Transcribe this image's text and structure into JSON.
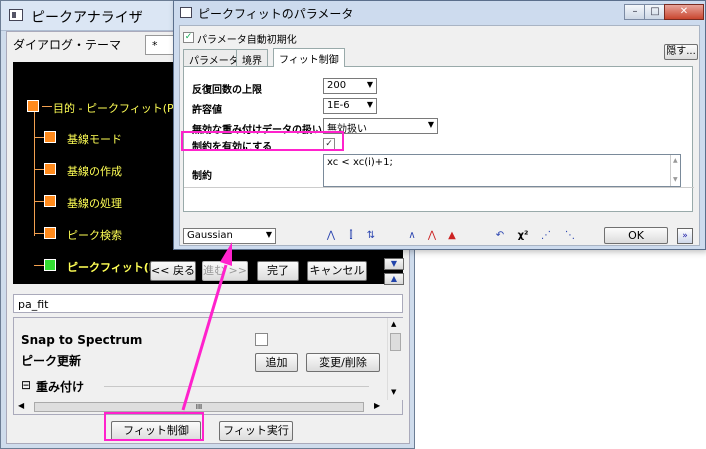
{
  "peak_analyzer": {
    "title": "ピークアナライザ",
    "theme_label": "ダイアログ・テーマ",
    "theme_value": "*",
    "tree": {
      "root": "目的 - ピークフィット(Pro)",
      "items": [
        "基線モード",
        "基線の作成",
        "基線の処理",
        "ピーク検索",
        "ピークフィット(Pro)"
      ]
    },
    "nav": {
      "prev": "<< 戻る",
      "next": "進む >>",
      "finish": "完了",
      "cancel": "キャンセル"
    },
    "output_name": "pa_fit",
    "panel": {
      "snap_label": "Snap to Spectrum",
      "peak_update_label": "ピーク更新",
      "add_button": "追加",
      "modify_button": "変更/削除",
      "weight_section": "重み付け",
      "collapse_glyph": "⊟",
      "hscroll_thumb": "III"
    },
    "bottom_buttons": {
      "fit_control": "フィット制御",
      "fit_run": "フィット実行"
    }
  },
  "fit_params": {
    "title": "ピークフィットのパラメータ",
    "auto_init_label": "パラメータ自動初期化",
    "auto_init_checked": true,
    "hide_button": "隠す...",
    "tabs": [
      "パラメータ",
      "境界",
      "フィット制御"
    ],
    "active_tab": 2,
    "rows": {
      "max_iter_label": "反復回数の上限",
      "max_iter_value": "200",
      "tolerance_label": "許容値",
      "tolerance_value": "1E-6",
      "invalid_weight_label": "無効な重み付けデータの扱い",
      "invalid_weight_value": "無効扱い",
      "enable_constraints_label": "制約を有効にする",
      "enable_constraints_checked": true,
      "constraints_label": "制約",
      "constraints_text": "xc < xc(i)+1;"
    },
    "function_value": "Gaussian",
    "ok_button": "OK"
  },
  "colors": {
    "highlight": "#ff22cc"
  }
}
